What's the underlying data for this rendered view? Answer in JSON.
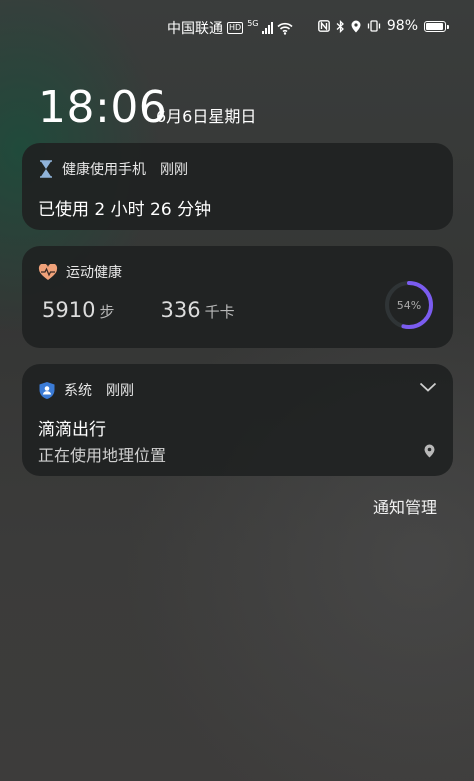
{
  "status_bar": {
    "carrier": "中国联通",
    "hd_badge": "HD",
    "network": "5G",
    "battery": "98%",
    "battery_level": 0.98
  },
  "lock": {
    "time": "18:06",
    "date": "6月6日星期日"
  },
  "notifications": [
    {
      "app": "健康使用手机",
      "when": "刚刚",
      "body": "已使用 2 小时 26 分钟",
      "icon": "hourglass-icon"
    },
    {
      "app": "运动健康",
      "icon": "heart-icon",
      "steps_value": "5910",
      "steps_unit": "步",
      "cal_value": "336",
      "cal_unit": "千卡",
      "progress_label": "54%",
      "progress": 0.54,
      "accent": "#7b5cf0"
    },
    {
      "app": "系统",
      "when": "刚刚",
      "title": "滴滴出行",
      "body": "正在使用地理位置",
      "icon": "person-shield-icon"
    }
  ],
  "footer": {
    "manage_label": "通知管理"
  }
}
